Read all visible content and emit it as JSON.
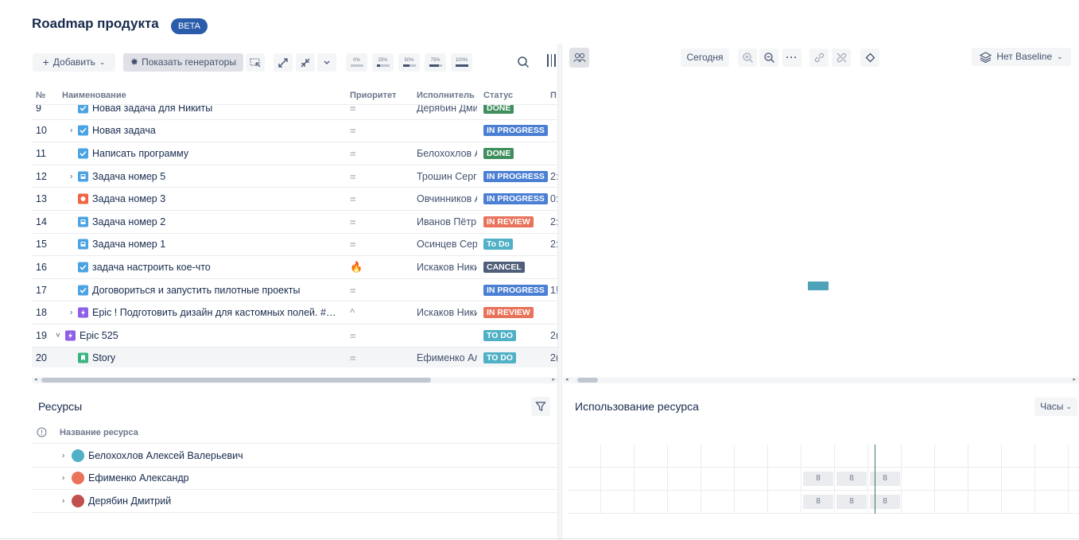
{
  "header": {
    "title": "Roadmap продукта",
    "badge": "BETA"
  },
  "toolbar": {
    "add_label": "Добавить",
    "generators_label": "Показать генераторы",
    "progress_presets": [
      {
        "label": "0%",
        "fill": 0
      },
      {
        "label": "25%",
        "fill": 0.25
      },
      {
        "label": "50%",
        "fill": 0.5
      },
      {
        "label": "75%",
        "fill": 0.75
      },
      {
        "label": "100%",
        "fill": 1
      }
    ]
  },
  "grid": {
    "columns": {
      "num": "№",
      "name": "Наименование",
      "priority": "Приоритет",
      "assignee": "Исполнитель",
      "status": "Статус",
      "extra": "П"
    },
    "rows": [
      {
        "num": "9",
        "name": "Новая задача для Никиты",
        "type": "task",
        "chevron": "",
        "priority": "=",
        "assignee": "Дерябин Дми",
        "status": "DONE",
        "status_color": "#3f8f5e",
        "date": ""
      },
      {
        "num": "10",
        "name": "Новая задача",
        "type": "task",
        "chevron": "›",
        "priority": "=",
        "assignee": "",
        "status": "IN PROGRESS",
        "status_color": "#4a7fd4",
        "date": ""
      },
      {
        "num": "11",
        "name": "Написать программу",
        "type": "task",
        "chevron": "",
        "priority": "=",
        "assignee": "Белохохлов А",
        "status": "DONE",
        "status_color": "#3f8f5e",
        "date": ""
      },
      {
        "num": "12",
        "name": "Задача номер 5",
        "type": "story-blue",
        "chevron": "›",
        "priority": "=",
        "assignee": "Трошин Серге",
        "status": "IN PROGRESS",
        "status_color": "#4a7fd4",
        "date": "2:"
      },
      {
        "num": "13",
        "name": "Задача номер 3",
        "type": "bug",
        "chevron": "",
        "priority": "=",
        "assignee": "Овчинников А",
        "status": "IN PROGRESS",
        "status_color": "#4a7fd4",
        "date": "0:"
      },
      {
        "num": "14",
        "name": "Задача номер 2",
        "type": "story-blue",
        "chevron": "",
        "priority": "=",
        "assignee": "Иванов Пётр",
        "status": "IN REVIEW",
        "status_color": "#e8725a",
        "date": "2:"
      },
      {
        "num": "15",
        "name": "Задача номер 1",
        "type": "story-blue",
        "chevron": "",
        "priority": "=",
        "assignee": "Осинцев Серг",
        "status": "To Do",
        "status_color": "#4fb0c6",
        "date": "2:"
      },
      {
        "num": "16",
        "name": "задача настроить кое-что",
        "type": "task",
        "chevron": "",
        "priority": "🔥",
        "assignee": "Искаков Ники",
        "status": "CANCEL",
        "status_color": "#505f79",
        "date": ""
      },
      {
        "num": "17",
        "name": "Договориться и запустить пилотные проекты",
        "type": "task",
        "chevron": "",
        "priority": "=",
        "assignee": "",
        "status": "IN PROGRESS",
        "status_color": "#4a7fd4",
        "date": "1!"
      },
      {
        "num": "18",
        "name": "Epic ! Подготовить дизайн для кастомных полей. #Dep...",
        "type": "epic",
        "chevron": "›",
        "priority": "^",
        "assignee": "Искаков Ники",
        "status": "IN REVIEW",
        "status_color": "#e8725a",
        "date": ""
      },
      {
        "num": "19",
        "name": "Epic 525",
        "type": "epic",
        "chevron": "˅",
        "priority": "=",
        "assignee": "",
        "status": "TO DO",
        "status_color": "#4fb0c6",
        "date": "2("
      },
      {
        "num": "20",
        "name": "Story",
        "type": "story-green",
        "chevron": "",
        "priority": "=",
        "assignee": "Ефименко Ал",
        "status": "TO DO",
        "status_color": "#4fb0c6",
        "date": "2("
      }
    ]
  },
  "gantt": {
    "today_label": "Сегодня",
    "baseline_label": "Нет Baseline"
  },
  "resources": {
    "title": "Ресурсы",
    "column": "Название ресурса",
    "rows": [
      {
        "name": "Белохохлов Алексей Валерьевич",
        "avatar_color": "#4fb0c6"
      },
      {
        "name": "Ефименко Александр",
        "avatar_color": "#e8725a"
      },
      {
        "name": "Дерябин Дмитрий",
        "avatar_color": "#c0504d"
      }
    ]
  },
  "usage": {
    "title": "Использование ресурса",
    "unit_label": "Часы",
    "values": [
      "8",
      "8",
      "8"
    ]
  }
}
